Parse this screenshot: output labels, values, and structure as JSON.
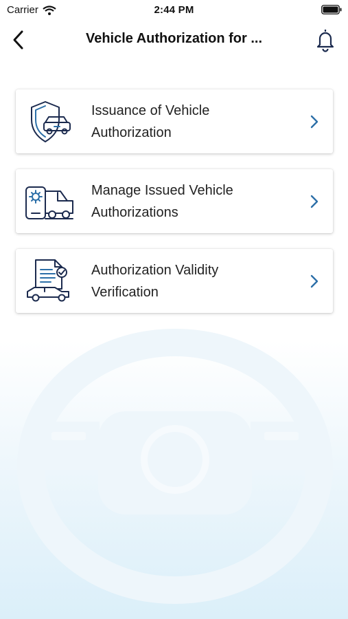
{
  "status_bar": {
    "carrier": "Carrier",
    "time": "2:44 PM"
  },
  "header": {
    "title": "Vehicle Authorization for ...",
    "back_icon": "chevron-left-icon",
    "notification_icon": "bell-icon"
  },
  "menu": {
    "items": [
      {
        "label_line1": "Issuance of Vehicle",
        "label_line2": "Authorization",
        "icon": "shield-car-icon"
      },
      {
        "label_line1": "Manage Issued Vehicle",
        "label_line2": "Authorizations",
        "icon": "phone-gear-van-icon"
      },
      {
        "label_line1": "Authorization Validity",
        "label_line2": "Verification",
        "icon": "document-check-car-icon"
      }
    ]
  },
  "colors": {
    "icon_navy": "#1b2a4e",
    "icon_accent": "#2c6fa8",
    "chevron": "#2c6fa8",
    "watermark": "#e9f3f9"
  }
}
